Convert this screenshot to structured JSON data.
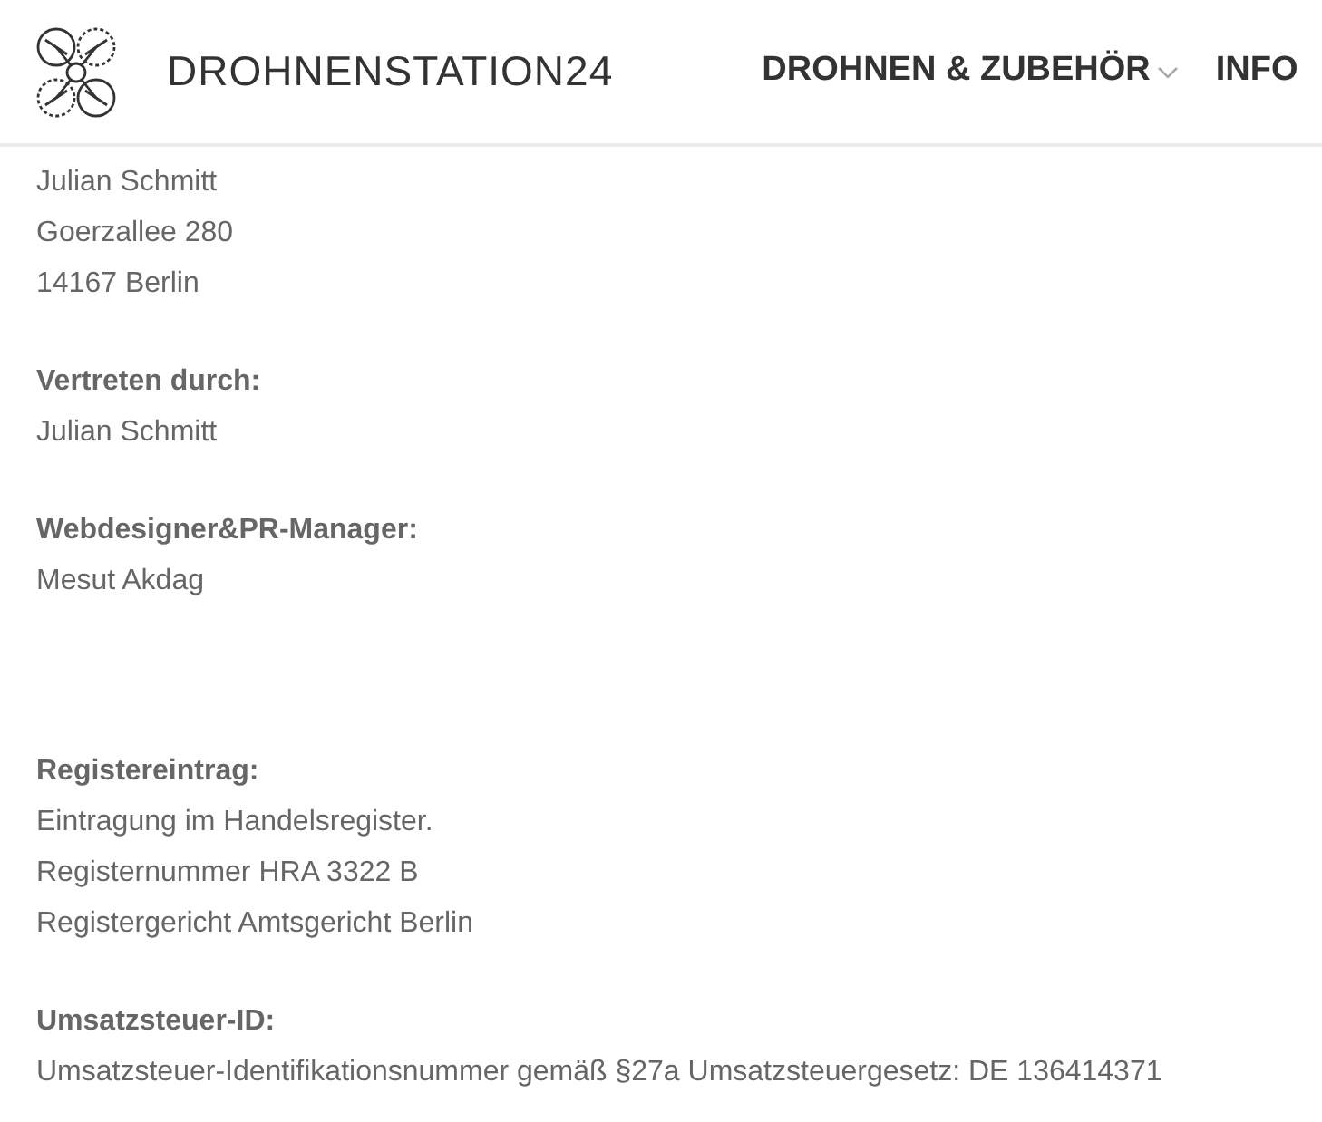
{
  "header": {
    "brand": "DROHNENSTATION24",
    "nav": [
      {
        "label": "DROHNEN & ZUBEHÖR",
        "dropdown": true
      },
      {
        "label": "INFO",
        "dropdown": false
      }
    ]
  },
  "sections": [
    {
      "lines": [
        "Julian Schmitt",
        "Goerzallee 280",
        "14167 Berlin"
      ]
    },
    {
      "heading": "Vertreten durch:",
      "lines": [
        "Julian Schmitt"
      ]
    },
    {
      "heading": "Webdesigner&PR-Manager:",
      "lines": [
        "Mesut Akdag"
      ]
    }
  ],
  "register_sections": [
    {
      "heading": "Registereintrag:",
      "lines": [
        "Eintragung im Handelsregister.",
        "Registernummer HRA 3322 B",
        "Registergericht Amtsgericht Berlin"
      ]
    },
    {
      "heading": "Umsatzsteuer-ID:",
      "lines": [
        "Umsatzsteuer-Identifikationsnummer gemäß §27a Umsatzsteuergesetz: DE 136414371"
      ]
    }
  ]
}
